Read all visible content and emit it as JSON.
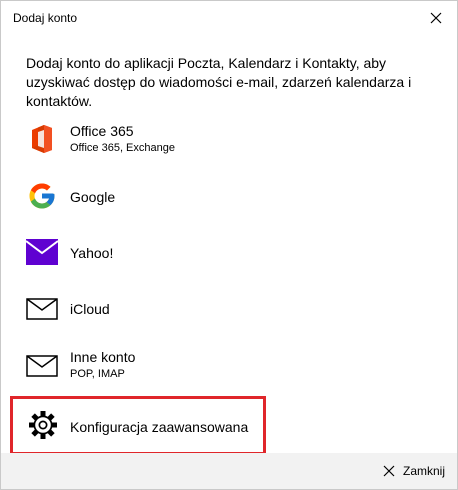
{
  "window": {
    "title": "Dodaj konto"
  },
  "intro_text": "Dodaj konto do aplikacji Poczta, Kalendarz i Kontakty, aby uzyskiwać dostęp do wiadomości e-mail, zdarzeń kalendarza i kontaktów.",
  "accounts": [
    {
      "name": "Office 365",
      "sub": "Office 365, Exchange",
      "icon": "office365-icon"
    },
    {
      "name": "Google",
      "sub": "",
      "icon": "google-icon"
    },
    {
      "name": "Yahoo!",
      "sub": "",
      "icon": "yahoo-mail-icon"
    },
    {
      "name": "iCloud",
      "sub": "",
      "icon": "envelope-icon"
    },
    {
      "name": "Inne konto",
      "sub": "POP, IMAP",
      "icon": "envelope-icon"
    }
  ],
  "advanced": {
    "label": "Konfiguracja zaawansowana",
    "icon": "gear-icon",
    "highlight_color": "#e0262a"
  },
  "footer": {
    "close_label": "Zamknij"
  },
  "colors": {
    "yahoo_purple": "#5f01d1",
    "footer_bg": "#f2f2f2"
  }
}
